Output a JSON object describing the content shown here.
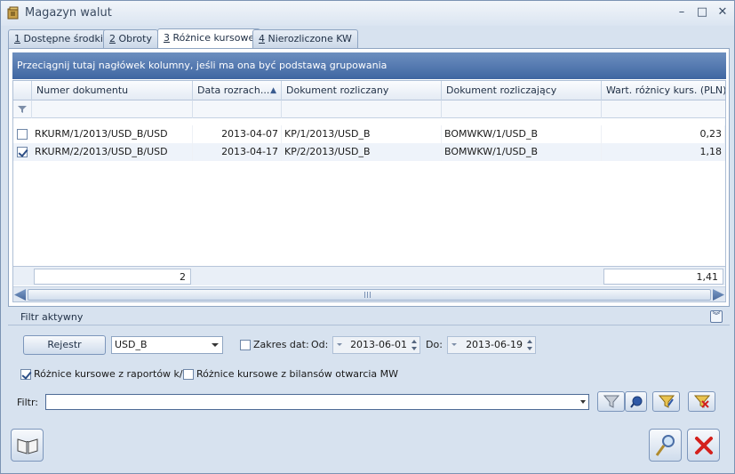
{
  "window": {
    "title": "Magazyn walut"
  },
  "tabs": [
    {
      "key": "1",
      "label": "Dostępne środki"
    },
    {
      "key": "2",
      "label": "Obroty"
    },
    {
      "key": "3",
      "label": "Różnice kursowe"
    },
    {
      "key": "4",
      "label": "Nierozliczone KW"
    }
  ],
  "grid": {
    "group_hint": "Przeciągnij tutaj nagłówek kolumny, jeśli ma ona być podstawą grupowania",
    "columns": [
      "Numer dokumentu",
      "Data rozrach...",
      "Dokument rozliczany",
      "Dokument rozliczający",
      "Wart. różnicy kurs. (PLN)"
    ],
    "sort_indicator": "▲",
    "rows": [
      {
        "checked": false,
        "numer": "RKURM/1/2013/USD_B/USD",
        "data": "2013-04-07",
        "rozliczany": "KP/1/2013/USD_B",
        "rozliczajacy": "BOMWKW/1/USD_B",
        "wart": "0,23"
      },
      {
        "checked": true,
        "numer": "RKURM/2/2013/USD_B/USD",
        "data": "2013-04-17",
        "rozliczany": "KP/2/2013/USD_B",
        "rozliczajacy": "BOMWKW/1/USD_B",
        "wart": "1,18"
      }
    ],
    "footer": {
      "count": "2",
      "sum": "1,41"
    }
  },
  "filter": {
    "header": "Filtr aktywny",
    "rejestr_label": "Rejestr",
    "rejestr_value": "USD_B",
    "zakres_label": "Zakres dat:",
    "od_label": "Od:",
    "od_value": "2013-06-01",
    "do_label": "Do:",
    "do_value": "2013-06-19",
    "raporty_label": "Różnice kursowe z raportów k/b",
    "bilans_label": "Różnice kursowe z bilansów otwarcia MW",
    "filtr_label": "Filtr:",
    "filtr_value": ""
  },
  "colors": {
    "accent": "#3f66a2",
    "window_bg": "#d7e2ef"
  }
}
